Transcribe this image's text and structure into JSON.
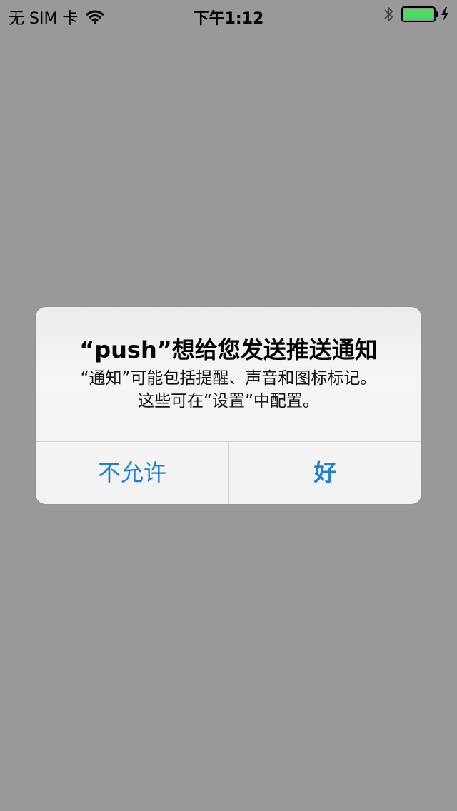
{
  "status_bar": {
    "carrier": "无 SIM 卡",
    "time": "下午1:12",
    "icons": [
      "wifi-icon",
      "bluetooth-icon",
      "battery-charging-icon"
    ]
  },
  "alert": {
    "title": "“push”想给您发送推送通知",
    "message_lines": [
      "“通知”可能包括提醒、声音和图标标记。",
      "这些可在“设置”中配置。"
    ],
    "buttons": {
      "cancel": "不允许",
      "ok": "好"
    }
  },
  "colors": {
    "background": "#999999",
    "button_text": "#1e7fd8",
    "battery_green": "#4cd964"
  }
}
